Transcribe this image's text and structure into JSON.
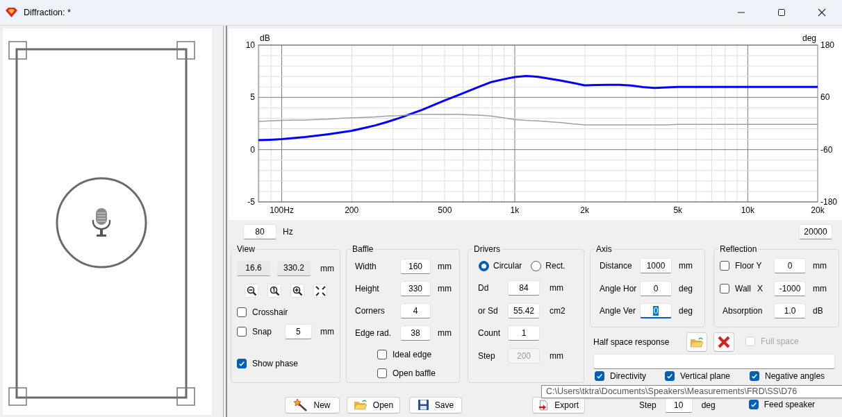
{
  "window": {
    "title": "Diffraction: *"
  },
  "chart": {
    "chart_data": {
      "type": "line",
      "grid": true,
      "ylabel": "dB",
      "y2label": "deg",
      "ylim": [
        -5,
        10
      ],
      "y2lim": [
        -180,
        180
      ],
      "yticks": [
        -5,
        0,
        5,
        10
      ],
      "y2ticks": [
        -180,
        -60,
        60,
        180
      ],
      "categories": [
        null,
        null,
        "100Hz",
        null,
        null,
        null,
        null,
        null,
        "200",
        null,
        null,
        null,
        null,
        null,
        null,
        null,
        "500",
        null,
        null,
        null,
        null,
        null,
        "1k",
        null,
        null,
        null,
        null,
        null,
        "2k",
        null,
        null,
        null,
        null,
        null,
        null,
        null,
        "5k",
        null,
        null,
        null,
        null,
        null,
        "10k",
        null,
        null,
        null,
        null,
        null,
        "20k"
      ],
      "series": [
        {
          "color": "#0000ff",
          "values": [
            0.9,
            0.95,
            1.0,
            1.1,
            1.2,
            1.33,
            1.47,
            1.63,
            1.8,
            2.05,
            2.31,
            2.63,
            2.99,
            3.38,
            3.78,
            4.25,
            4.71,
            5.15,
            5.6,
            6.04,
            6.47,
            6.72,
            6.95,
            7.05,
            6.97,
            6.79,
            6.6,
            6.38,
            6.15,
            6.18,
            6.2,
            6.2,
            6.13,
            5.99,
            5.9,
            5.95,
            6.0,
            6.0,
            6.0,
            6.0,
            6.0,
            6.0,
            6.0,
            6.0,
            6.0,
            6.0,
            6.0,
            6.0,
            6.0
          ]
        },
        {
          "color": "#a0a0a0",
          "axis": "y2",
          "values": [
            5,
            6,
            7,
            8,
            8,
            9,
            10,
            12,
            13,
            14,
            15,
            17,
            18,
            20,
            21,
            21,
            21,
            21,
            20,
            19,
            17,
            13,
            9,
            7,
            6,
            4,
            2,
            -1,
            -3,
            -3,
            -3,
            -3,
            -3,
            -3,
            -3,
            -3,
            -2,
            -2,
            -2,
            -2,
            -2,
            -2,
            -2,
            -2,
            -2,
            -2,
            -2,
            -2,
            -2
          ]
        }
      ]
    }
  },
  "frequency_range": {
    "min": "80",
    "unit": "Hz",
    "max": "20000"
  },
  "view": {
    "title": "View",
    "readouts": [
      "16.6",
      "330.2"
    ],
    "unit": "mm",
    "crosshair": {
      "label": "Crosshair",
      "checked": false
    },
    "snap": {
      "label": "Snap",
      "checked": false,
      "value": "5",
      "unit": "mm"
    },
    "show_phase": {
      "label": "Show phase",
      "checked": true
    }
  },
  "baffle": {
    "title": "Baffle",
    "fields": [
      {
        "label": "Width",
        "value": "160",
        "unit": "mm"
      },
      {
        "label": "Height",
        "value": "330",
        "unit": "mm"
      },
      {
        "label": "Corners",
        "value": "4"
      },
      {
        "label": "Edge rad.",
        "value": "38",
        "unit": "mm"
      }
    ],
    "options": [
      {
        "label": "Ideal edge",
        "checked": false
      },
      {
        "label": "Open baffle",
        "checked": false
      }
    ]
  },
  "drivers": {
    "title": "Drivers",
    "shapes": [
      {
        "label": "Circular",
        "selected": true
      },
      {
        "label": "Rect.",
        "selected": false
      }
    ],
    "fields": [
      {
        "label": "Dd",
        "value": "84",
        "unit": "mm",
        "disabled": false
      },
      {
        "label": "or Sd",
        "value": "55.42",
        "unit": "cm2",
        "disabled": false
      },
      {
        "label": "Count",
        "value": "1",
        "disabled": false
      },
      {
        "label": "Step",
        "value": "200",
        "unit": "mm",
        "disabled": true
      }
    ]
  },
  "axis": {
    "title": "Axis",
    "fields": [
      {
        "label": "Distance",
        "value": "1000",
        "unit": "mm",
        "focused": false
      },
      {
        "label": "Angle Hor",
        "value": "0",
        "unit": "deg",
        "focused": false
      },
      {
        "label": "Angle Ver",
        "value": "0",
        "unit": "deg",
        "focused": true
      }
    ]
  },
  "reflection": {
    "title": "Reflection",
    "fields": [
      {
        "kind": "checkbox",
        "label": "Floor Y",
        "checked": false,
        "value": "0",
        "unit": "mm"
      },
      {
        "kind": "checkbox",
        "label": "Wall",
        "suffix": "X",
        "checked": false,
        "value": "-1000",
        "unit": "mm"
      },
      {
        "kind": "plain",
        "label": "Absorption",
        "value": "1.0",
        "unit": "dB"
      }
    ]
  },
  "half_space": {
    "label": "Half space response",
    "full_space": {
      "label": "Full space",
      "checked": false,
      "disabled": true
    }
  },
  "plot_options": [
    {
      "label": "Directivity",
      "checked": true
    },
    {
      "label": "Vertical plane",
      "checked": true
    },
    {
      "label": "Negative angles",
      "checked": true
    }
  ],
  "buttons": [
    {
      "label": "New"
    },
    {
      "label": "Open"
    },
    {
      "label": "Save"
    },
    {
      "label": "Export"
    }
  ],
  "step": {
    "label": "Step",
    "value": "10",
    "unit": "deg"
  },
  "feed_speaker": {
    "label": "Feed speaker",
    "checked": true
  },
  "tooltip": {
    "text": "C:\\Users\\tktra\\Documents\\Speakers\\Measurements\\FRD\\SS\\D76"
  }
}
